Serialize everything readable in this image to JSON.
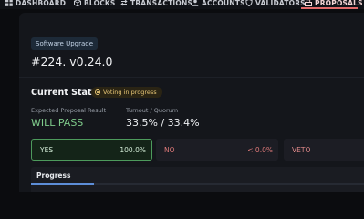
{
  "nav": {
    "items": [
      {
        "label": "DASHBOARD",
        "icon": "grid-icon"
      },
      {
        "label": "BLOCKS",
        "icon": "cube-icon"
      },
      {
        "label": "TRANSACTIONS",
        "icon": "transfer-icon"
      },
      {
        "label": "ACCOUNTS",
        "icon": "user-icon"
      },
      {
        "label": "VALIDATORS",
        "icon": "shield-icon"
      },
      {
        "label": "PROPOSALS",
        "icon": "ballot-icon"
      }
    ],
    "active": "PROPOSALS",
    "accent": "#e06a6a"
  },
  "proposal": {
    "type_tag": "Software Upgrade",
    "number": "#224.",
    "title": " v0.24.0"
  },
  "status": {
    "heading": "Current Status",
    "badge": "Voting in progress",
    "expected_label": "Expected Proposal Result",
    "expected_value": "WILL PASS",
    "turnout_label": "Turnout / Quorum",
    "turnout_value": "33.5% / 33.4%"
  },
  "votes": {
    "yes": {
      "label": "YES",
      "value": "100.0%"
    },
    "no": {
      "label": "NO",
      "value": "< 0.0%"
    },
    "veto": {
      "label": "VETO",
      "value": ""
    }
  },
  "progress": {
    "title": "Progress",
    "fraction": 0.19
  },
  "colors": {
    "background": "#0b0c0f",
    "panel": "#14161b",
    "pass": "#7ec98a",
    "badge_text": "#e8c776",
    "yes_border": "#4d9a5c",
    "no_text": "#e07a7a"
  }
}
